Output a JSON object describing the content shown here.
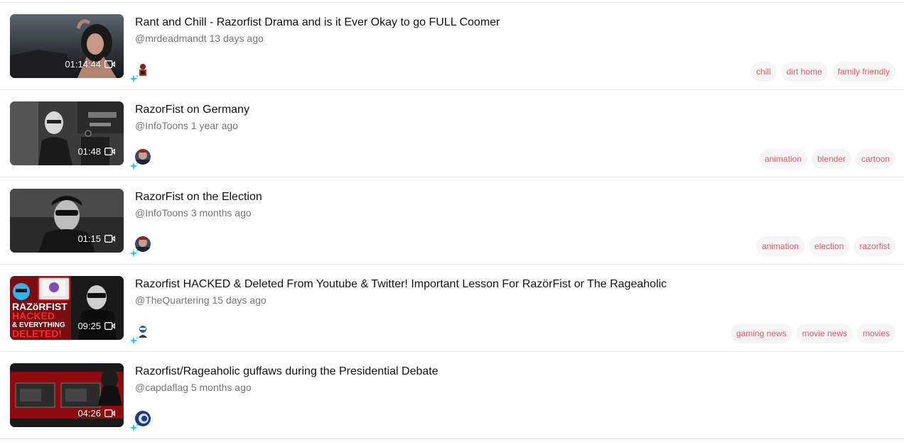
{
  "videos": [
    {
      "title": "Rant and Chill - Razorfist Drama and is it Ever Okay to go FULL Coomer",
      "channel": "@mrdeadmandt",
      "age": "13 days ago",
      "duration": "01:14:44",
      "tags": [
        "chill",
        "dirt home",
        "family friendly"
      ]
    },
    {
      "title": "RazorFist on Germany",
      "channel": "@InfoToons",
      "age": "1 year ago",
      "duration": "01:48",
      "tags": [
        "animation",
        "blender",
        "cartoon"
      ]
    },
    {
      "title": "RazorFist on the Election",
      "channel": "@InfoToons",
      "age": "3 months ago",
      "duration": "01:15",
      "tags": [
        "animation",
        "election",
        "razorfist"
      ]
    },
    {
      "title": "Razorfist HACKED & Deleted From Youtube & Twitter! Important Lesson For RazörFist or The Rageaholic",
      "channel": "@TheQuartering",
      "age": "15 days ago",
      "duration": "09:25",
      "thumb_text": [
        "RAZöRFIST",
        "HACKED",
        "& EVERYTHING",
        "DELETED!"
      ],
      "tags": [
        "gaming news",
        "movie news",
        "movies"
      ]
    },
    {
      "title": "Razorfist/Rageaholic guffaws during the Presidential Debate",
      "channel": "@capdaflag",
      "age": "5 months ago",
      "duration": "04:26",
      "tags": []
    }
  ],
  "colors": {
    "tag_text": "#e25b64",
    "tag_bg": "#f5f5f5",
    "meta_text": "#757575",
    "sparkle": "#22c6e6"
  }
}
